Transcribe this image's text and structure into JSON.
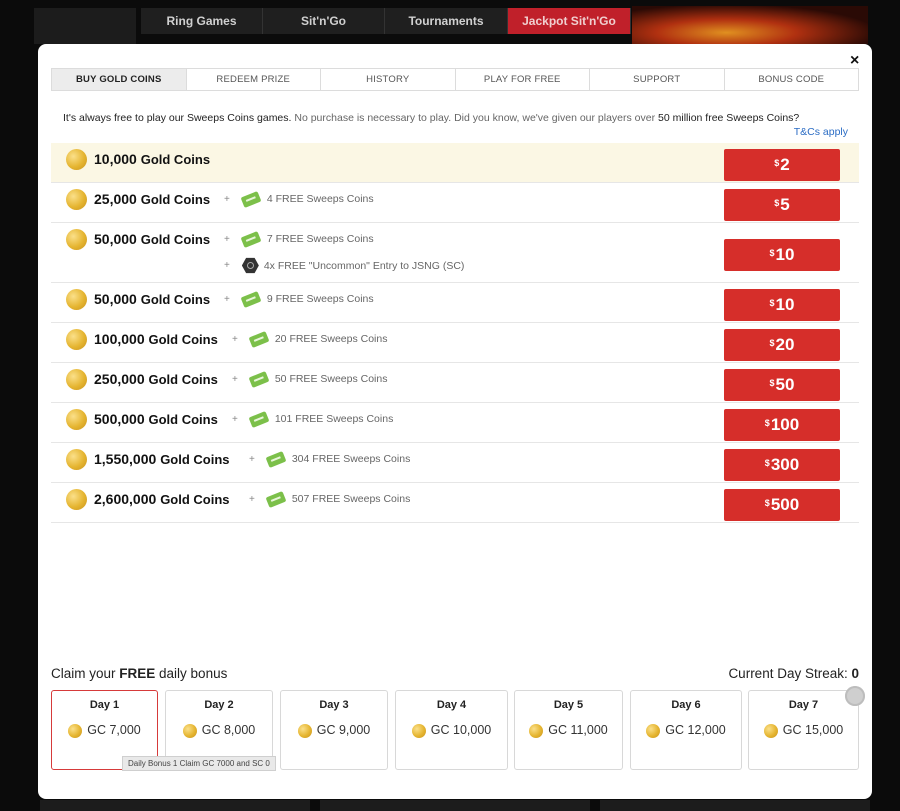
{
  "background": {
    "nav_tabs": [
      "Ring Games",
      "Sit'n'Go",
      "Tournaments",
      "Jackpot Sit'n'Go"
    ],
    "active_tab": 3
  },
  "modal": {
    "close_label": "×",
    "tabs": [
      {
        "label": "BUY GOLD COINS",
        "active": true
      },
      {
        "label": "REDEEM PRIZE",
        "active": false
      },
      {
        "label": "HISTORY",
        "active": false
      },
      {
        "label": "PLAY FOR FREE",
        "active": false
      },
      {
        "label": "SUPPORT",
        "active": false
      },
      {
        "label": "BONUS CODE",
        "active": false
      }
    ],
    "intro": {
      "part1": "It's always free to play our Sweeps Coins games.",
      "part2": " No purchase is necessary to play. Did you know, we've given our players over ",
      "part3": "50 million free Sweeps Coins?",
      "tcs": "T&Cs apply"
    },
    "packages": [
      {
        "amount": "10,000",
        "unit": "Gold Coins",
        "bonuses": [],
        "price": "2",
        "highlight": true
      },
      {
        "amount": "25,000",
        "unit": "Gold Coins",
        "bonuses": [
          {
            "type": "ticket",
            "text": "4 FREE Sweeps Coins"
          }
        ],
        "price": "5"
      },
      {
        "amount": "50,000",
        "unit": "Gold Coins",
        "bonuses": [
          {
            "type": "ticket",
            "text": "7 FREE Sweeps Coins"
          },
          {
            "type": "hex",
            "text": "4x FREE \"Uncommon\" Entry to JSNG (SC)"
          }
        ],
        "price": "10"
      },
      {
        "amount": "50,000",
        "unit": "Gold Coins",
        "bonuses": [
          {
            "type": "ticket",
            "text": "9 FREE Sweeps Coins"
          }
        ],
        "price": "10"
      },
      {
        "amount": "100,000",
        "unit": "Gold Coins",
        "bonuses": [
          {
            "type": "ticket",
            "text": "20 FREE Sweeps Coins"
          }
        ],
        "price": "20"
      },
      {
        "amount": "250,000",
        "unit": "Gold Coins",
        "bonuses": [
          {
            "type": "ticket",
            "text": "50 FREE Sweeps Coins"
          }
        ],
        "price": "50"
      },
      {
        "amount": "500,000",
        "unit": "Gold Coins",
        "bonuses": [
          {
            "type": "ticket",
            "text": "101 FREE Sweeps Coins"
          }
        ],
        "price": "100"
      },
      {
        "amount": "1,550,000",
        "unit": "Gold Coins",
        "bonuses": [
          {
            "type": "ticket",
            "text": "304 FREE Sweeps Coins"
          }
        ],
        "price": "300"
      },
      {
        "amount": "2,600,000",
        "unit": "Gold Coins",
        "bonuses": [
          {
            "type": "ticket",
            "text": "507 FREE Sweeps Coins"
          }
        ],
        "price": "500"
      }
    ],
    "currency_symbol": "$",
    "plus_sign": "+",
    "claim": {
      "prefix": "Claim your ",
      "bold": "FREE",
      "suffix": " daily bonus"
    },
    "streak": {
      "label": "Current Day Streak: ",
      "value": "0"
    },
    "days": [
      {
        "label": "Day 1",
        "value": "GC 7,000",
        "active": true
      },
      {
        "label": "Day 2",
        "value": "GC 8,000"
      },
      {
        "label": "Day 3",
        "value": "GC 9,000"
      },
      {
        "label": "Day 4",
        "value": "GC 10,000"
      },
      {
        "label": "Day 5",
        "value": "GC 11,000"
      },
      {
        "label": "Day 6",
        "value": "GC 12,000"
      },
      {
        "label": "Day 7",
        "value": "GC 15,000"
      }
    ],
    "tooltip": "Daily Bonus 1 Claim GC 7000 and SC 0"
  },
  "colors": {
    "accent": "#d62e2a",
    "link": "#2b6cc4",
    "highlight_row": "#fbf7e4",
    "free_ticket": "#7cc04a"
  }
}
